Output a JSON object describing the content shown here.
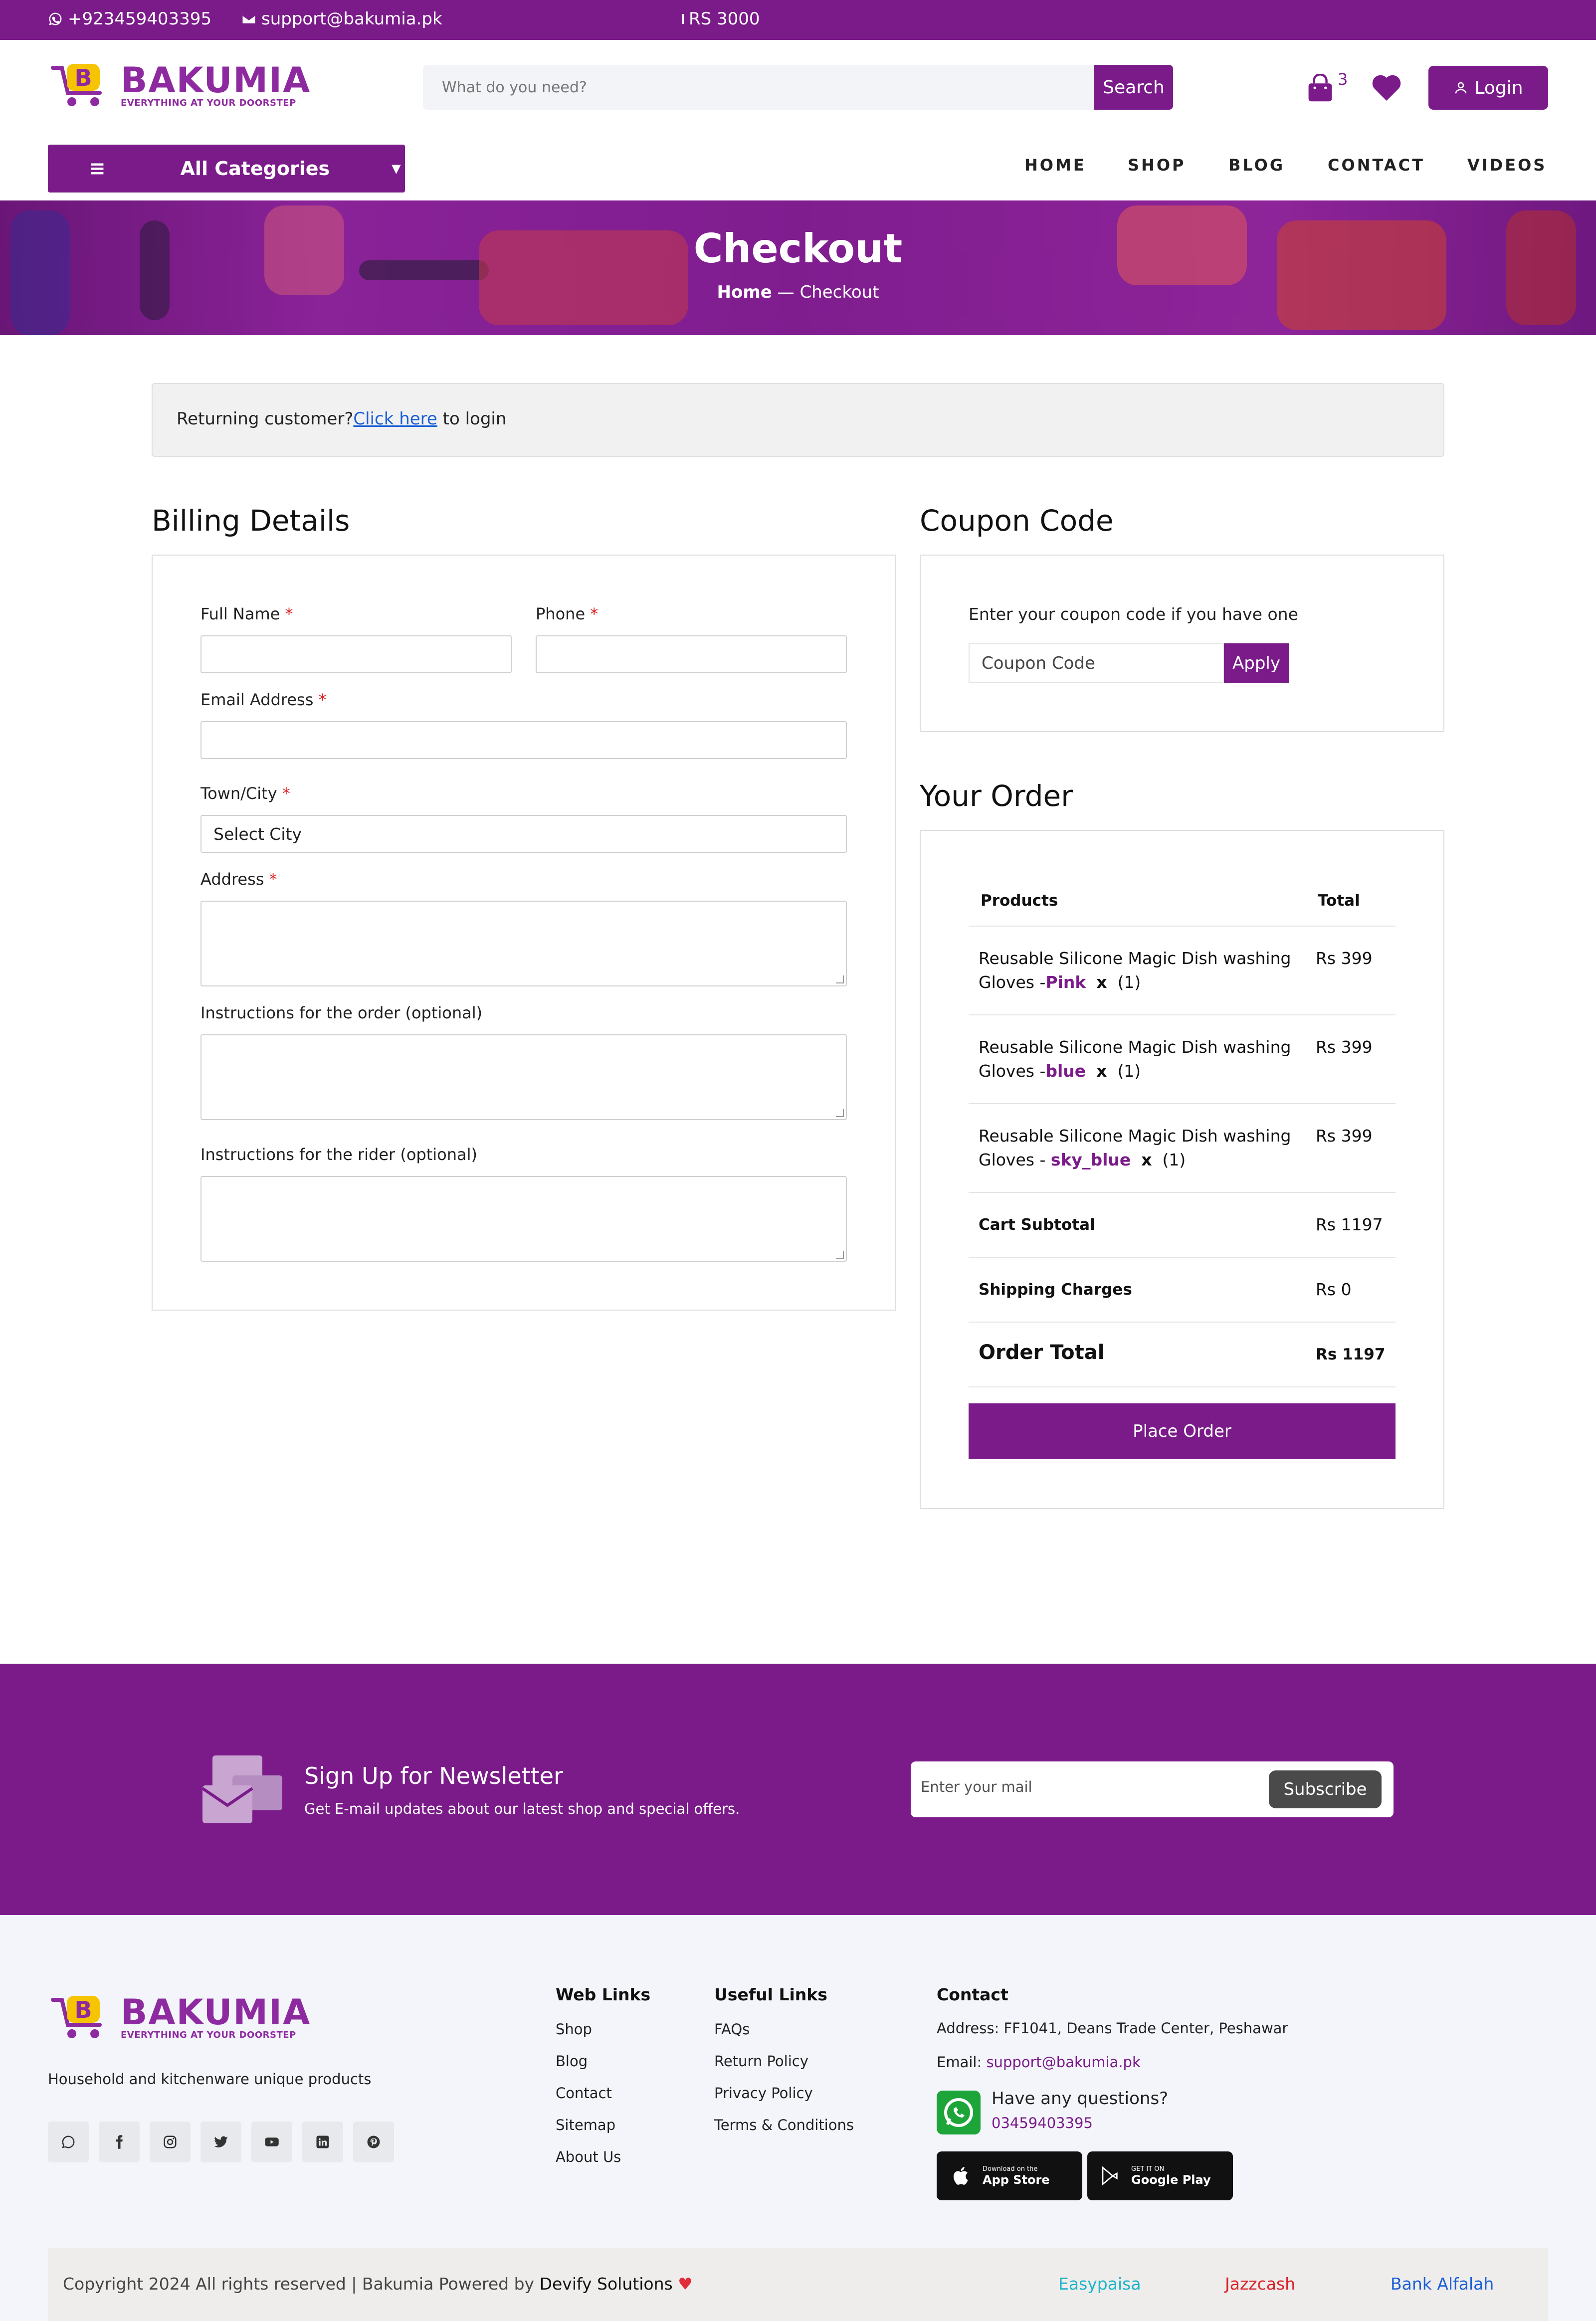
{
  "topbar": {
    "phone": "+923459403395",
    "email": "support@bakumia.pk",
    "promo": "RS 3000"
  },
  "brand": {
    "name": "BAKUMIA",
    "tagline": "EVERYTHING AT YOUR DOORSTEP",
    "mark_letter": "B"
  },
  "header": {
    "search_placeholder": "What do you need?",
    "search_button": "Search",
    "cart_count": "3",
    "login_label": "Login"
  },
  "nav": {
    "categories_label": "All Categories",
    "items": [
      "HOME",
      "SHOP",
      "BLOG",
      "CONTACT",
      "VIDEOS"
    ]
  },
  "banner": {
    "title": "Checkout",
    "crumb_home": "Home",
    "crumb_sep": "—",
    "crumb_current": "Checkout"
  },
  "returning": {
    "text": "Returning customer?",
    "link": "Click here",
    "suffix": " to login"
  },
  "billing": {
    "title": "Billing Details",
    "full_name": "Full Name",
    "phone": "Phone",
    "email": "Email Address",
    "city": "Town/City",
    "city_value": "Select City",
    "address": "Address",
    "order_instructions": "Instructions for the order (optional)",
    "rider_instructions": "Instructions for the rider (optional)",
    "required_mark": "*"
  },
  "coupon": {
    "title": "Coupon Code",
    "prompt": "Enter your coupon code if you have one",
    "placeholder": "Coupon Code",
    "apply": "Apply"
  },
  "order": {
    "title": "Your Order",
    "col_products": "Products",
    "col_total": "Total",
    "items": [
      {
        "name_line1": "Reusable Silicone Magic Dish washing",
        "name_line2": "Gloves -",
        "variant": "Pink",
        "qty_mark": "x",
        "qty": "(1)",
        "price": "Rs 399"
      },
      {
        "name_line1": "Reusable Silicone Magic Dish washing",
        "name_line2": "Gloves -",
        "variant": "blue",
        "qty_mark": "x",
        "qty": "(1)",
        "price": "Rs 399"
      },
      {
        "name_line1": "Reusable Silicone Magic Dish washing",
        "name_line2": "Gloves - ",
        "variant": "sky_blue",
        "qty_mark": "x",
        "qty": "(1)",
        "price": "Rs 399"
      }
    ],
    "subtotal_label": "Cart Subtotal",
    "subtotal": "Rs 1197",
    "shipping_label": "Shipping Charges",
    "shipping": "Rs 0",
    "total_label": "Order Total",
    "total": "Rs 1197",
    "place_order": "Place Order"
  },
  "newsletter": {
    "title": "Sign Up for Newsletter",
    "subtitle": "Get E-mail updates about our latest shop and special offers.",
    "placeholder": "Enter your mail",
    "button": "Subscribe"
  },
  "footer": {
    "about": "Household and kitchenware unique products",
    "socials": [
      "whatsapp-icon",
      "facebook-icon",
      "instagram-icon",
      "twitter-icon",
      "youtube-icon",
      "linkedin-icon",
      "pinterest-icon"
    ],
    "web_links_title": "Web Links",
    "web_links": [
      "Shop",
      "Blog",
      "Contact",
      "Sitemap",
      "About Us"
    ],
    "useful_links_title": "Useful Links",
    "useful_links": [
      "FAQs",
      "Return Policy",
      "Privacy Policy",
      "Terms & Conditions"
    ],
    "contact_title": "Contact",
    "address": "Address: FF1041, Deans Trade Center, Peshawar",
    "email_label": "Email: ",
    "email": "support@bakumia.pk",
    "question": "Have any questions?",
    "whatsapp": "03459403395",
    "appstore_small": "Download on the",
    "appstore_big": "App Store",
    "googleplay_small": "GET IT ON",
    "googleplay_big": "Google Play",
    "copyright": "Copyright 2024 All rights reserved | Bakumia Powered by ",
    "powered": "Devify Solutions",
    "payments": [
      "Easypaisa",
      "Jazzcash",
      "Bank Alfalah"
    ]
  },
  "colors": {
    "brand_purple": "#7b1b8a",
    "easypaisa": "#18b4c8",
    "jazzcash": "#d9222a",
    "alfalah": "#1a5fd6"
  }
}
